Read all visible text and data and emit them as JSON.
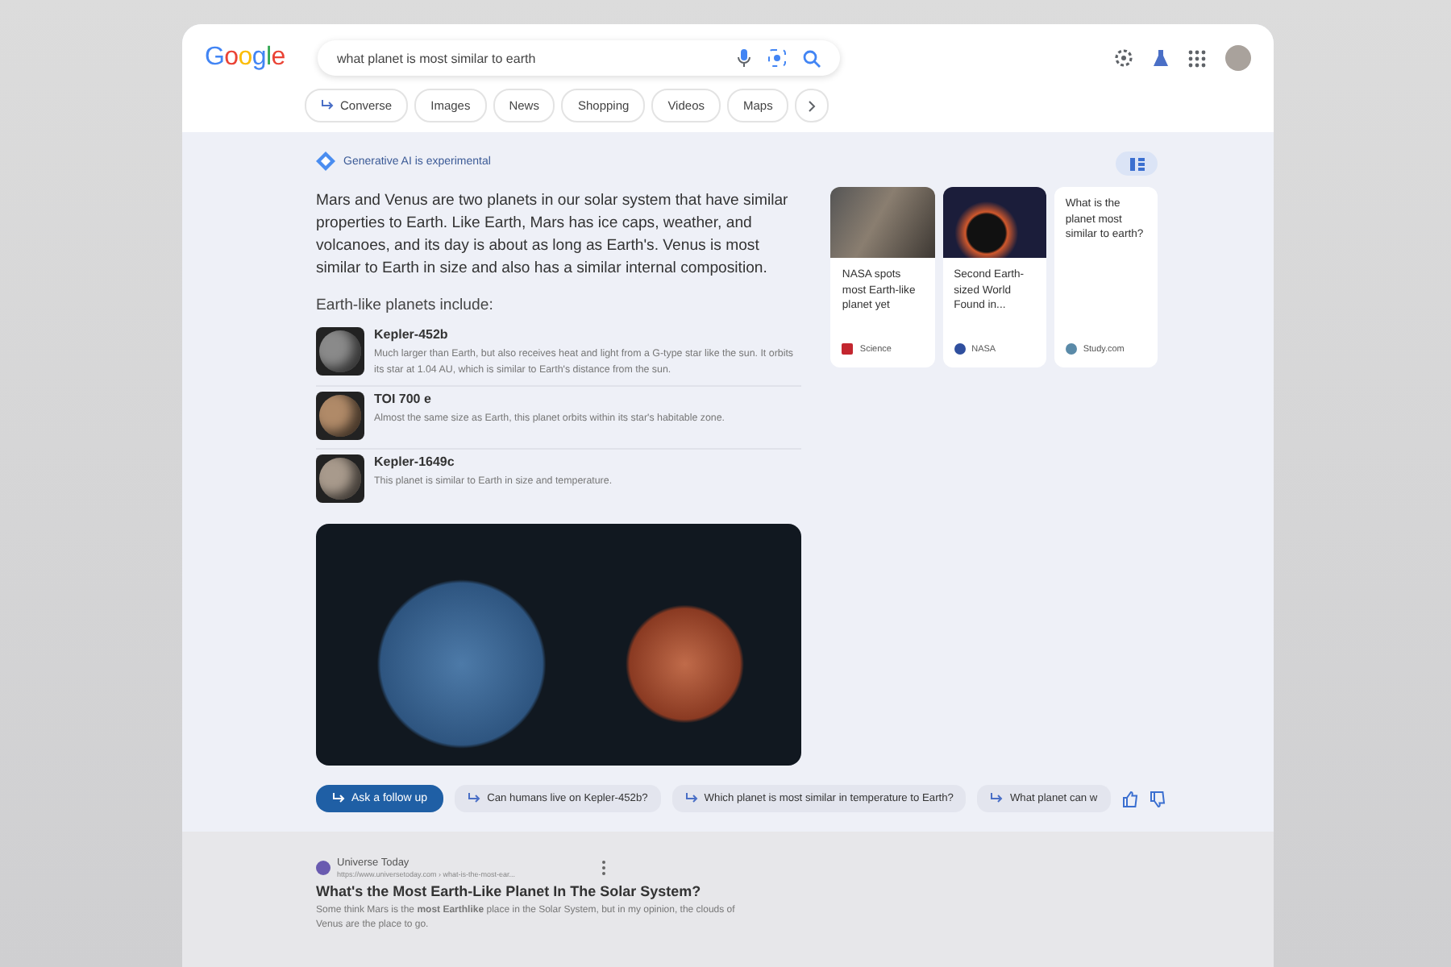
{
  "header": {
    "logo": "Google",
    "query": "what planet is most similar to earth"
  },
  "tabs": [
    {
      "label": "Converse",
      "kind": "converse",
      "selected": false
    },
    {
      "label": "Images",
      "kind": "plain",
      "selected": false
    },
    {
      "label": "News",
      "kind": "plain",
      "selected": false
    },
    {
      "label": "Shopping",
      "kind": "plain",
      "selected": false
    },
    {
      "label": "Videos",
      "kind": "plain",
      "selected": false
    },
    {
      "label": "Maps",
      "kind": "plain",
      "selected": false
    }
  ],
  "ai_overview": {
    "badge": "Generative AI is experimental",
    "summary": "Mars and Venus are two planets in our solar system that have similar properties to Earth. Like Earth, Mars has ice caps, weather, and volcanoes, and its day is about as long as Earth's. Venus is most similar to Earth in size and also has a similar internal composition.",
    "list_heading": "Earth-like planets include:",
    "planets": [
      {
        "name": "Kepler-452b",
        "description": "Much larger than Earth, but also receives heat and light from a G-type star like the sun. It orbits its star at 1.04 AU, which is similar to Earth's distance from the sun.",
        "color": "#8a8a8a"
      },
      {
        "name": "TOI 700 e",
        "description": "Almost the same size as Earth, this planet orbits within its star's habitable zone.",
        "color": "#b08a68"
      },
      {
        "name": "Kepler-1649c",
        "description": "This planet is similar to Earth in size and temperature.",
        "color": "#a89a8c"
      }
    ],
    "sources": [
      {
        "title": "NASA spots most Earth-like planet yet",
        "source": "Science",
        "kind": "image"
      },
      {
        "title": "Second Earth-sized World Found in...",
        "source": "NASA",
        "kind": "image"
      },
      {
        "title": "What is the planet most similar to earth?",
        "source": "Study.com",
        "kind": "text"
      }
    ],
    "follow_up": {
      "button": "Ask a follow up",
      "suggestions": [
        "Can humans live on Kepler-452b?",
        "Which planet is most similar in temperature to Earth?",
        "What planet can w"
      ]
    }
  },
  "result": {
    "site": "Universe Today",
    "url": "https://www.universetoday.com › what-is-the-most-ear...",
    "title": "What's the Most Earth-Like Planet In The Solar System?",
    "snippet": "Some think Mars is the **most Earthlike** place in the Solar System, but in my opinion, the clouds of Venus are the place to go."
  }
}
